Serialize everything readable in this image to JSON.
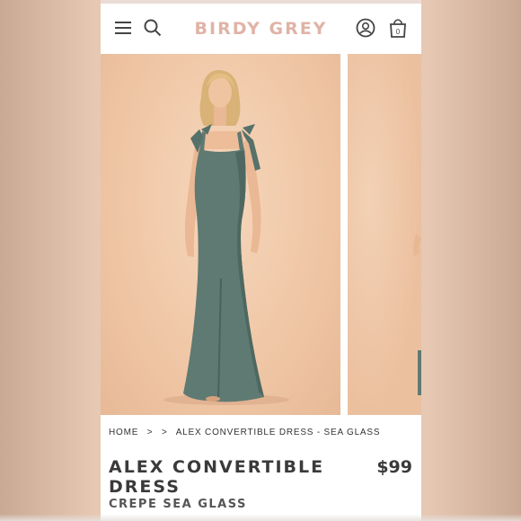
{
  "header": {
    "logo": "BIRDY GREY",
    "cart_count": "0",
    "menu_icon": "hamburger-menu-icon",
    "search_icon": "search-icon",
    "account_icon": "user-account-icon",
    "cart_icon": "shopping-bag-icon"
  },
  "breadcrumb": {
    "home": "HOME",
    "sep1": ">",
    "sep2": ">",
    "current": "ALEX CONVERTIBLE DRESS - SEA GLASS"
  },
  "product": {
    "title": "ALEX CONVERTIBLE DRESS",
    "price": "$99",
    "color": "CREPE SEA GLASS"
  },
  "colors": {
    "accent": "#e0b3a6",
    "dress": "#5f7a72",
    "backdrop": "#efc6a5"
  }
}
